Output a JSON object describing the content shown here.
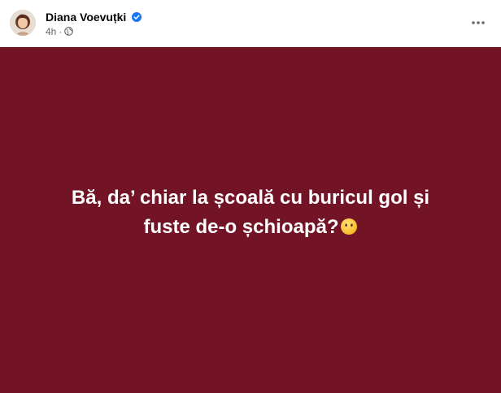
{
  "post": {
    "author_name": "Diana Voevuțki",
    "timestamp": "4h",
    "separator": "·",
    "audience_icon": "globe-icon",
    "verified_icon": "verified-badge-icon",
    "more_icon": "more-horizontal-icon",
    "text": "Bă, da’ chiar la școală cu buricul gol și fuste de-o șchioapă?",
    "emoji": "face-without-mouth-emoji",
    "background_color": "#731426",
    "text_color": "#ffffff"
  }
}
